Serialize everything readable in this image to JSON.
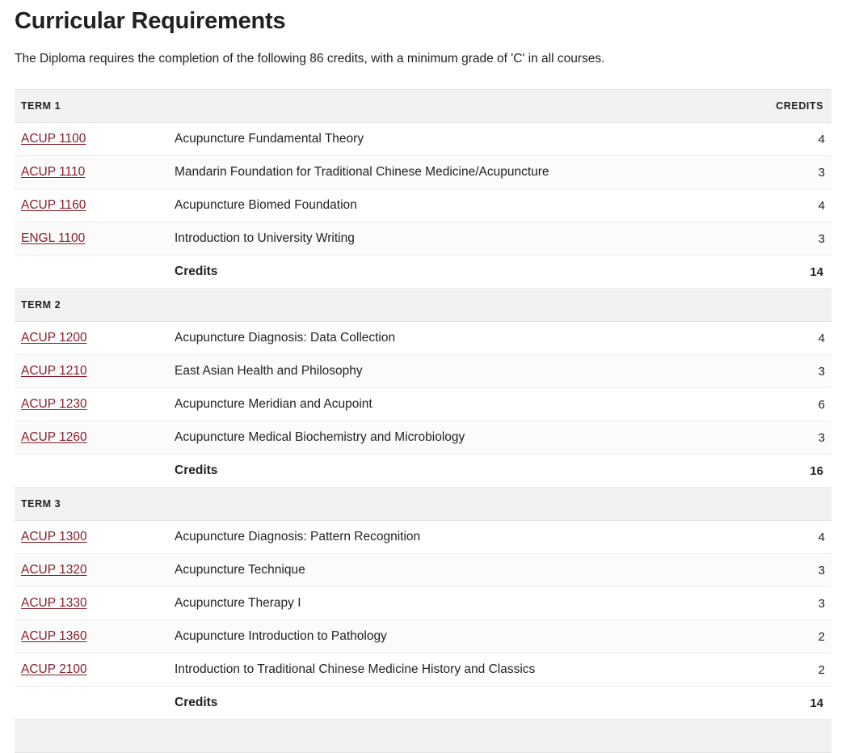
{
  "page": {
    "title": "Curricular Requirements",
    "intro": "The Diploma requires the completion of the following 86 credits, with a minimum grade of 'C' in all courses."
  },
  "table": {
    "columns": {
      "code": "",
      "title": "",
      "credits": "CREDITS"
    },
    "subtotal_label": "Credits",
    "accent_link_color": "#8a1c2b",
    "header_background": "#f2f2f2",
    "row_alt_background": "#fbfbfb",
    "terms": [
      {
        "label": "TERM 1",
        "courses": [
          {
            "code": "ACUP 1100",
            "title": "Acupuncture Fundamental Theory",
            "credits": "4"
          },
          {
            "code": "ACUP 1110",
            "title": "Mandarin Foundation for Traditional Chinese Medicine/Acupuncture",
            "credits": "3"
          },
          {
            "code": "ACUP 1160",
            "title": "Acupuncture Biomed Foundation",
            "credits": "4"
          },
          {
            "code": "ENGL 1100",
            "title": "Introduction to University Writing",
            "credits": "3"
          }
        ],
        "subtotal": "14"
      },
      {
        "label": "TERM 2",
        "courses": [
          {
            "code": "ACUP 1200",
            "title": "Acupuncture Diagnosis: Data Collection",
            "credits": "4"
          },
          {
            "code": "ACUP 1210",
            "title": "East Asian Health and Philosophy",
            "credits": "3"
          },
          {
            "code": "ACUP 1230",
            "title": "Acupuncture Meridian and Acupoint",
            "credits": "6"
          },
          {
            "code": "ACUP 1260",
            "title": "Acupuncture Medical Biochemistry and Microbiology",
            "credits": "3"
          }
        ],
        "subtotal": "16"
      },
      {
        "label": "TERM 3",
        "courses": [
          {
            "code": "ACUP 1300",
            "title": "Acupuncture Diagnosis: Pattern Recognition",
            "credits": "4"
          },
          {
            "code": "ACUP 1320",
            "title": "Acupuncture Technique",
            "credits": "3"
          },
          {
            "code": "ACUP 1330",
            "title": "Acupuncture Therapy I",
            "credits": "3"
          },
          {
            "code": "ACUP 1360",
            "title": "Acupuncture Introduction to Pathology",
            "credits": "2"
          },
          {
            "code": "ACUP 2100",
            "title": "Introduction to Traditional Chinese Medicine History and Classics",
            "credits": "2"
          }
        ],
        "subtotal": "14"
      },
      {
        "label": "",
        "courses": [],
        "subtotal": ""
      }
    ]
  }
}
